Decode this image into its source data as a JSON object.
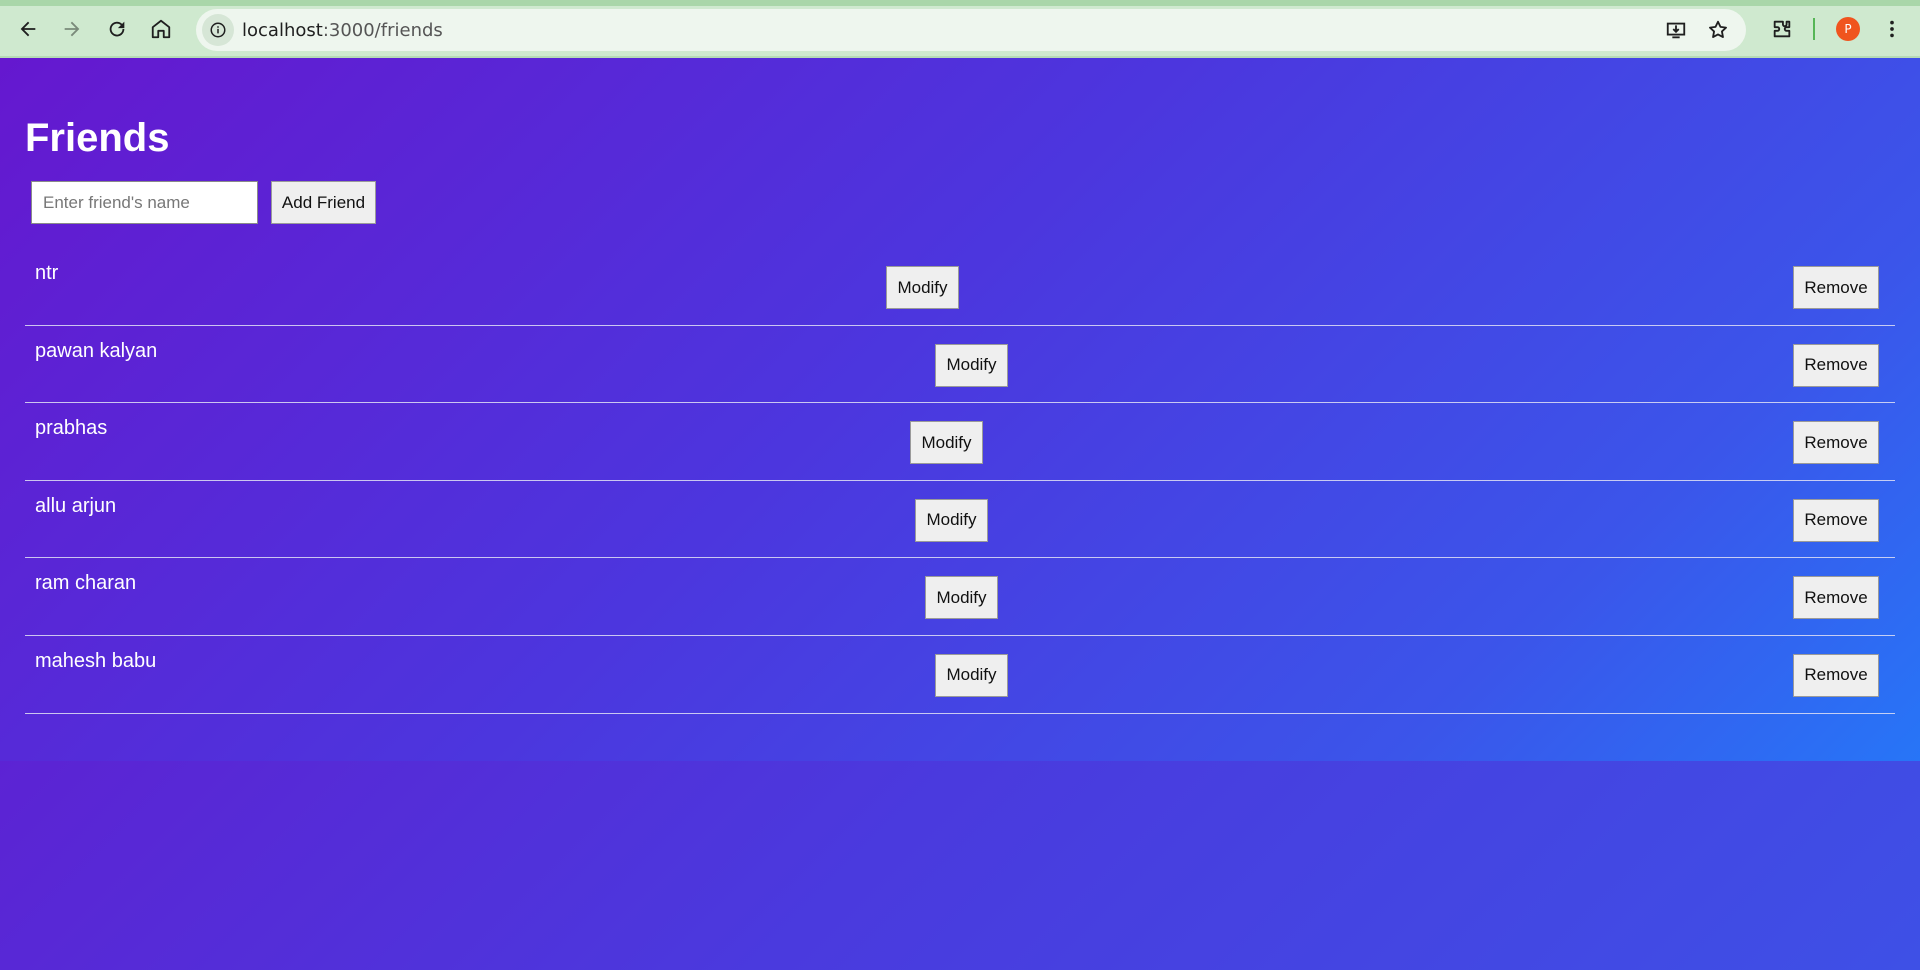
{
  "browser": {
    "url_host": "localhost",
    "url_path": ":3000/friends",
    "avatar_letter": "P",
    "icons": [
      "back-arrow-icon",
      "forward-arrow-icon",
      "reload-icon",
      "home-icon",
      "site-info-icon",
      "install-app-icon",
      "bookmark-star-icon",
      "extensions-puzzle-icon",
      "more-menu-icon"
    ]
  },
  "page": {
    "title": "Friends",
    "input_placeholder": "Enter friend's name",
    "input_value": "",
    "add_label": "Add Friend"
  },
  "friends": [
    {
      "name": "ntr",
      "modify_label": "Modify",
      "remove_label": "Remove"
    },
    {
      "name": "pawan kalyan",
      "modify_label": "Modify",
      "remove_label": "Remove"
    },
    {
      "name": "prabhas",
      "modify_label": "Modify",
      "remove_label": "Remove"
    },
    {
      "name": "allu arjun",
      "modify_label": "Modify",
      "remove_label": "Remove"
    },
    {
      "name": "ram charan",
      "modify_label": "Modify",
      "remove_label": "Remove"
    },
    {
      "name": "mahesh babu",
      "modify_label": "Modify",
      "remove_label": "Remove"
    }
  ],
  "colors": {
    "browser_bar": "#cfe9cf",
    "gradient_start": "#6518cf",
    "gradient_end": "#2775f7",
    "avatar": "#f0541e"
  }
}
